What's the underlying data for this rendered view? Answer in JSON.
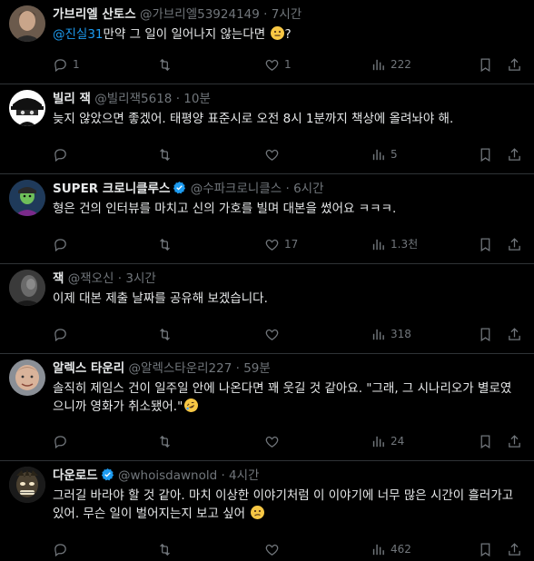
{
  "tweets": [
    {
      "name": "가브리엘 산토스",
      "handle": "@가브리엘53924149",
      "time": "7시간",
      "verified": false,
      "mention": "@진실31",
      "text": "만약 그 일이 일어나지 않는다면",
      "emoji": "neutral-face",
      "text_after": "?",
      "replies": "1",
      "retweets": "",
      "likes": "1",
      "views": "222"
    },
    {
      "name": "빌리 잭",
      "handle": "@빌리잭5618",
      "time": "10분",
      "verified": false,
      "mention": "",
      "text": "늦지 않았으면 좋겠어. 태평양 표준시로 오전 8시 1분까지 책상에 올려놔야 해.",
      "emoji": "",
      "text_after": "",
      "replies": "",
      "retweets": "",
      "likes": "",
      "views": "5"
    },
    {
      "name": "SUPER 크로니클루스",
      "handle": "@수파크로니클스",
      "time": "6시간",
      "verified": true,
      "mention": "",
      "text": "형은 건의 인터뷰를 마치고 신의 가호를 빌며 대본을 썼어요 ㅋㅋㅋ.",
      "emoji": "",
      "text_after": "",
      "replies": "",
      "retweets": "",
      "likes": "17",
      "views": "1.3천"
    },
    {
      "name": "잭",
      "handle": "@잭오신",
      "time": "3시간",
      "verified": false,
      "mention": "",
      "text": "이제 대본 제출 날짜를 공유해 보겠습니다.",
      "emoji": "",
      "text_after": "",
      "replies": "",
      "retweets": "",
      "likes": "",
      "views": "318"
    },
    {
      "name": "알렉스 타운리",
      "handle": "@알렉스타운리227",
      "time": "59분",
      "verified": false,
      "mention": "",
      "text": "솔직히 제임스 건이 일주일 안에 나온다면 꽤 웃길 것 같아요. \"그래, 그 시나리오가 별로였으니까 영화가 취소됐어.\"",
      "emoji": "rofl",
      "text_after": "",
      "replies": "",
      "retweets": "",
      "likes": "",
      "views": "24"
    },
    {
      "name": "다운로드",
      "handle": "@whoisdawnold",
      "time": "4시간",
      "verified": true,
      "mention": "",
      "text": "그러길 바라야 할 것 같아. 마치 이상한 이야기처럼 이 이야기에 너무 많은 시간이 흘러가고 있어. 무슨 일이 벌어지는지 보고 싶어",
      "emoji": "confused-face",
      "text_after": "",
      "replies": "",
      "retweets": "",
      "likes": "",
      "views": "462"
    }
  ],
  "header_separator": "·",
  "colors": {
    "background": "#000000",
    "text": "#e7e9ea",
    "muted": "#71767b",
    "link": "#1d9bf0",
    "verified": "#1d9bf0",
    "border": "#2f3336"
  }
}
